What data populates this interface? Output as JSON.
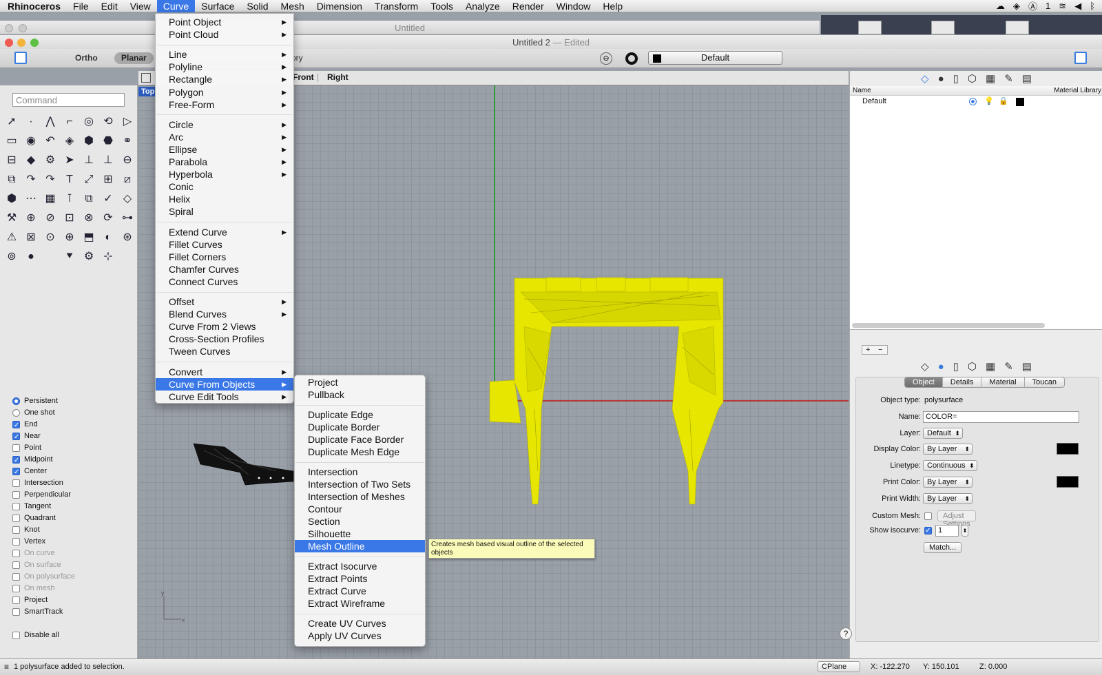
{
  "menubar": {
    "app": "Rhinoceros",
    "items": [
      "File",
      "Edit",
      "View",
      "Curve",
      "Surface",
      "Solid",
      "Mesh",
      "Dimension",
      "Transform",
      "Tools",
      "Analyze",
      "Render",
      "Window",
      "Help"
    ],
    "active": "Curve",
    "status_num": "1"
  },
  "background_window": {
    "title": "Untitled"
  },
  "window": {
    "title": "Untitled 2",
    "edited": "— Edited"
  },
  "toolbar": {
    "ortho": "Ortho",
    "planar": "Planar",
    "ory": "ory",
    "layer": "Default"
  },
  "command": {
    "placeholder": "Command"
  },
  "viewport_tabs": [
    "Front",
    "Right"
  ],
  "viewport_label": "Top",
  "osnaps": [
    {
      "label": "Persistent",
      "type": "radio",
      "on": true
    },
    {
      "label": "One shot",
      "type": "radio",
      "on": false
    },
    {
      "label": "End",
      "type": "check",
      "on": true
    },
    {
      "label": "Near",
      "type": "check",
      "on": true
    },
    {
      "label": "Point",
      "type": "check",
      "on": false
    },
    {
      "label": "Midpoint",
      "type": "check",
      "on": true
    },
    {
      "label": "Center",
      "type": "check",
      "on": true
    },
    {
      "label": "Intersection",
      "type": "check",
      "on": false
    },
    {
      "label": "Perpendicular",
      "type": "check",
      "on": false
    },
    {
      "label": "Tangent",
      "type": "check",
      "on": false
    },
    {
      "label": "Quadrant",
      "type": "check",
      "on": false
    },
    {
      "label": "Knot",
      "type": "check",
      "on": false
    },
    {
      "label": "Vertex",
      "type": "check",
      "on": false
    },
    {
      "label": "On curve",
      "type": "check",
      "on": false,
      "dim": true
    },
    {
      "label": "On surface",
      "type": "check",
      "on": false,
      "dim": true
    },
    {
      "label": "On polysurface",
      "type": "check",
      "on": false,
      "dim": true
    },
    {
      "label": "On mesh",
      "type": "check",
      "on": false,
      "dim": true
    },
    {
      "label": "Project",
      "type": "check",
      "on": false
    },
    {
      "label": "SmartTrack",
      "type": "check",
      "on": false
    },
    {
      "label": "",
      "type": "gap",
      "on": false
    },
    {
      "label": "Disable all",
      "type": "check",
      "on": false
    }
  ],
  "curve_menu": [
    {
      "label": "Point Object",
      "sub": true
    },
    {
      "label": "Point Cloud",
      "sub": true
    },
    {
      "sep": true
    },
    {
      "label": "Line",
      "sub": true
    },
    {
      "label": "Polyline",
      "sub": true
    },
    {
      "label": "Rectangle",
      "sub": true
    },
    {
      "label": "Polygon",
      "sub": true
    },
    {
      "label": "Free-Form",
      "sub": true
    },
    {
      "sep": true
    },
    {
      "label": "Circle",
      "sub": true
    },
    {
      "label": "Arc",
      "sub": true
    },
    {
      "label": "Ellipse",
      "sub": true
    },
    {
      "label": "Parabola",
      "sub": true
    },
    {
      "label": "Hyperbola",
      "sub": true
    },
    {
      "label": "Conic"
    },
    {
      "label": "Helix"
    },
    {
      "label": "Spiral"
    },
    {
      "sep": true
    },
    {
      "label": "Extend Curve",
      "sub": true
    },
    {
      "label": "Fillet Curves"
    },
    {
      "label": "Fillet Corners"
    },
    {
      "label": "Chamfer Curves"
    },
    {
      "label": "Connect Curves"
    },
    {
      "sep": true
    },
    {
      "label": "Offset",
      "sub": true
    },
    {
      "label": "Blend Curves",
      "sub": true
    },
    {
      "label": "Curve From 2 Views"
    },
    {
      "label": "Cross-Section Profiles"
    },
    {
      "label": "Tween Curves"
    },
    {
      "sep": true
    },
    {
      "label": "Convert",
      "sub": true
    },
    {
      "label": "Curve From Objects",
      "sub": true,
      "selected": true
    },
    {
      "label": "Curve Edit Tools",
      "sub": true
    }
  ],
  "submenu": [
    {
      "label": "Project"
    },
    {
      "label": "Pullback"
    },
    {
      "sep": true
    },
    {
      "label": "Duplicate Edge"
    },
    {
      "label": "Duplicate Border"
    },
    {
      "label": "Duplicate Face Border"
    },
    {
      "label": "Duplicate Mesh Edge"
    },
    {
      "sep": true
    },
    {
      "label": "Intersection"
    },
    {
      "label": "Intersection of Two Sets"
    },
    {
      "label": "Intersection of Meshes"
    },
    {
      "label": "Contour"
    },
    {
      "label": "Section"
    },
    {
      "label": "Silhouette"
    },
    {
      "label": "Mesh Outline",
      "selected": true
    },
    {
      "sep": true
    },
    {
      "label": "Extract Isocurve"
    },
    {
      "label": "Extract Points"
    },
    {
      "label": "Extract Curve"
    },
    {
      "label": "Extract Wireframe"
    },
    {
      "sep": true
    },
    {
      "label": "Create UV Curves"
    },
    {
      "label": "Apply UV Curves"
    }
  ],
  "tooltip": "Creates mesh based visual outline of the selected objects",
  "layers_panel": {
    "col_name": "Name",
    "col_material": "Material Library",
    "rows": [
      "Default"
    ]
  },
  "properties": {
    "tabs": [
      "Object",
      "Details",
      "Material",
      "Toucan"
    ],
    "active_tab": "Object",
    "object_type_label": "Object type:",
    "object_type": "polysurface",
    "name_label": "Name:",
    "name": "COLOR=",
    "layer_label": "Layer:",
    "layer": "Default",
    "display_color_label": "Display Color:",
    "display_color": "By Layer",
    "linetype_label": "Linetype:",
    "linetype": "Continuous",
    "print_color_label": "Print Color:",
    "print_color": "By Layer",
    "print_width_label": "Print Width:",
    "print_width": "By Layer",
    "custom_mesh_label": "Custom Mesh:",
    "adjust_settings": "Adjust Settings",
    "show_isocurve_label": "Show isocurve:",
    "isocurve_density": "1",
    "match": "Match..."
  },
  "status": {
    "message": "1 polysurface added to selection.",
    "cplane": "CPlane",
    "x": "X: -122.270",
    "y": "Y: 150.101",
    "z": "Z: 0.000"
  },
  "colors": {
    "accent": "#3b78e7",
    "mesh_yellow": "#e6e600",
    "axis_green": "#2f9a3a",
    "axis_red": "#b43a3a"
  }
}
